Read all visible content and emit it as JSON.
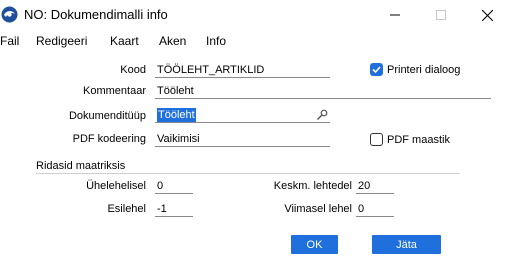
{
  "window": {
    "title": "NO: Dokumendimalli info",
    "icon": "app-logo-icon",
    "controls": {
      "minimize": "minimize-icon",
      "maximize": "maximize-icon",
      "close": "close-icon"
    }
  },
  "menu": [
    "Fail",
    "Redigeeri",
    "Kaart",
    "Aken",
    "Info"
  ],
  "form": {
    "kood": {
      "label": "Kood",
      "value": "TÖÖLEHT_ARTIKLID"
    },
    "kommentaar": {
      "label": "Kommentaar",
      "value": "Tööleht"
    },
    "dokumendituup": {
      "label": "Dokumenditüüp",
      "value": "Tööleht",
      "lookup_icon": "search-icon"
    },
    "pdf_kodeering": {
      "label": "PDF kodeering",
      "value": "Vaikimisi"
    },
    "printeri_dialoog": {
      "label": "Printeri dialoog",
      "checked": true
    },
    "pdf_maastik": {
      "label": "PDF maastik",
      "checked": false
    }
  },
  "matrix": {
    "section_label": "Ridasid maatriksis",
    "uhelehelisel": {
      "label": "Ühelehelisel",
      "value": "0"
    },
    "esilehel": {
      "label": "Esilehel",
      "value": "-1"
    },
    "keskm_lehtedel": {
      "label": "Keskm. lehtedel",
      "value": "20"
    },
    "viimasel_lehel": {
      "label": "Viimasel lehel",
      "value": "0"
    }
  },
  "buttons": {
    "ok": "OK",
    "cancel": "Jäta"
  },
  "colors": {
    "accent": "#1f6fdd",
    "text": "#000000",
    "background": "#ffffff"
  }
}
